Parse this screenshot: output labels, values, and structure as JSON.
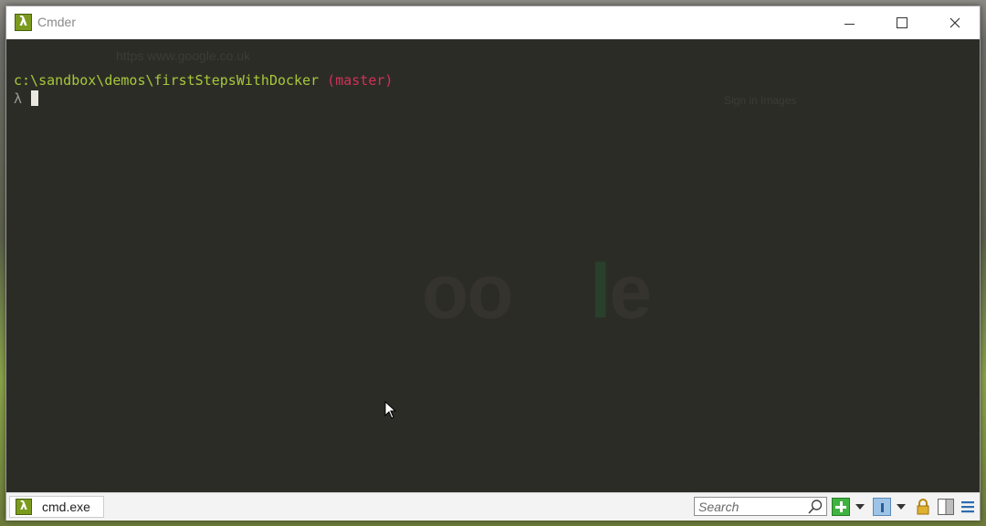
{
  "window": {
    "title": "Cmder",
    "app_icon_glyph": "λ",
    "controls": {
      "minimize": "minimize-icon",
      "maximize": "maximize-icon",
      "close": "close-icon"
    }
  },
  "terminal": {
    "path": "c:\\sandbox\\demos\\firstStepsWithDocker",
    "branch": "(master)",
    "prompt_symbol": "λ",
    "colors": {
      "background": "#2c2c27",
      "path": "#a6c83a",
      "branch": "#d23158"
    }
  },
  "background_ghost": {
    "url_text": "https   www.google.co.uk",
    "logo_text_a": "oo",
    "logo_text_l": "l",
    "logo_text_b": "e",
    "signin_text": "Sign in  Images"
  },
  "statusbar": {
    "tab_label": "cmd.exe",
    "tab_icon_glyph": "λ",
    "search_placeholder": "Search"
  }
}
